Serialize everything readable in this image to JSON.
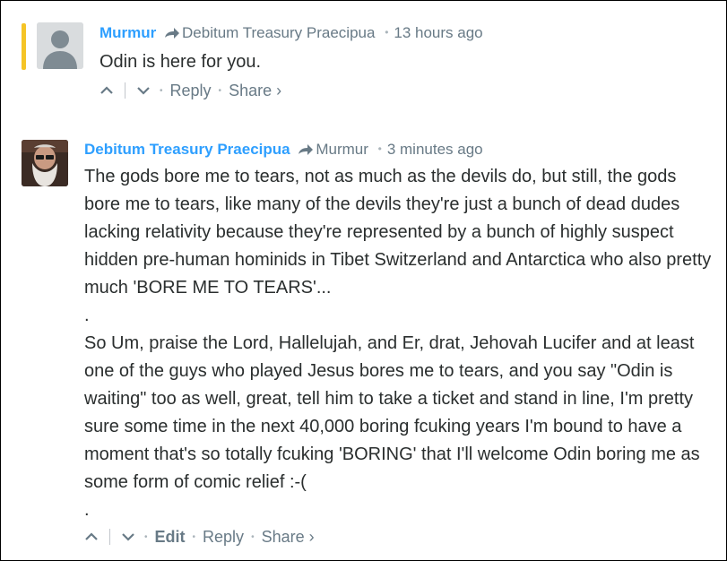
{
  "comments": [
    {
      "author": "Murmur",
      "reply_to": "Debitum Treasury Praecipua",
      "time": "13 hours ago",
      "body": [
        "Odin is here for you."
      ],
      "actions": {
        "reply": "Reply",
        "share": "Share ›"
      },
      "highlight_color": "#f5c426"
    },
    {
      "author": "Debitum Treasury Praecipua",
      "reply_to": "Murmur",
      "time": "3 minutes ago",
      "body": [
        "The gods bore me to tears, not as much as the devils do, but still, the gods bore me to tears, like many of the devils they're just a bunch of dead dudes lacking relativity because they're represented by a bunch of highly suspect hidden pre-human hominids in Tibet Switzerland and Antarctica who also pretty much 'BORE ME TO TEARS'...",
        ".",
        "So Um, praise the Lord, Hallelujah, and Er, drat, Jehovah Lucifer and at least one of the guys who played Jesus bores me to tears, and you say \"Odin is waiting\" too as well, great, tell him to take a ticket and stand in line, I'm pretty sure some time in the next 40,000 boring fcuking years I'm bound to have a moment that's so totally fcuking 'BORING' that I'll welcome Odin boring me as some form of comic relief :-(",
        "."
      ],
      "actions": {
        "edit": "Edit",
        "reply": "Reply",
        "share": "Share ›"
      }
    }
  ],
  "colors": {
    "author_link": "#2e9fff",
    "meta_text": "#687a86",
    "body_text": "#2a2e2e"
  }
}
